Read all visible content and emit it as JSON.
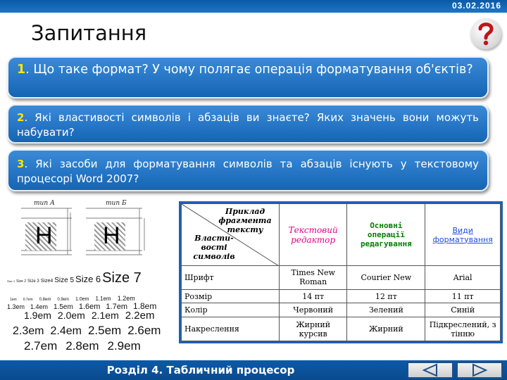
{
  "header": {
    "date": "03.02.2016",
    "title": "Запитання"
  },
  "questions": [
    {
      "num": "1",
      "text": ". Що таке формат? У чому полягає операція форматування об'єктів?"
    },
    {
      "num": "2",
      "text": ". Які властивості символів і абзаців ви знаєте? Яких значень вони можуть набувати?"
    },
    {
      "num": "3",
      "text": ". Які засоби для форматування символів та абзаців існують у текстовому процесорі Word 2007?"
    }
  ],
  "figure": {
    "type_a": "тип А",
    "type_b": "тип Б",
    "glyph": "Н",
    "size_rows": [
      [
        "Size 1",
        "Size 2",
        "Size 3",
        "Size4",
        "Size 5",
        "Size 6",
        "Size 7"
      ],
      [
        "1em",
        "0.7em",
        "0.8em",
        "0.9em",
        "1.0em",
        "1.1em",
        "1.2em"
      ],
      [
        "1.3em",
        "1.4em",
        "1.5em",
        "1.6em",
        "1.7em",
        "1.8em"
      ],
      [
        "1.9em",
        "2.0em",
        "2.1em",
        "2.2em"
      ],
      [
        "2.3em",
        "2.4em",
        "2.5em",
        "2.6em"
      ],
      [
        "2.7em",
        "2.8em",
        "2.9em"
      ]
    ]
  },
  "table": {
    "corner_top": "Приклад фрагмента тексту",
    "corner_bottom": "Власти-вості символів",
    "headers": [
      "Текстовий редактор",
      "Основні операції редагування",
      "Види форматування"
    ],
    "rows": [
      {
        "label": "Шрифт",
        "cells": [
          "Times New Roman",
          "Courier New",
          "Arial"
        ]
      },
      {
        "label": "Розмір",
        "cells": [
          "14 пт",
          "12 пт",
          "11 пт"
        ]
      },
      {
        "label": "Колір",
        "cells": [
          "Червоний",
          "Зелений",
          "Синій"
        ]
      },
      {
        "label": "Накреслення",
        "cells": [
          "Жирний курсив",
          "Жирний",
          "Підкреслений, з тінню"
        ]
      }
    ]
  },
  "footer": {
    "section": "Розділ 4. Табличний процесор"
  },
  "icons": {
    "question": "question-mark-icon",
    "prev": "prev-triangle-icon",
    "next": "next-triangle-icon"
  },
  "colors": {
    "accent_blue": "#1565b5",
    "question_number": "#ffe600",
    "header1": "#e0008a",
    "header2": "#008000",
    "header3": "#1a4fd8"
  }
}
